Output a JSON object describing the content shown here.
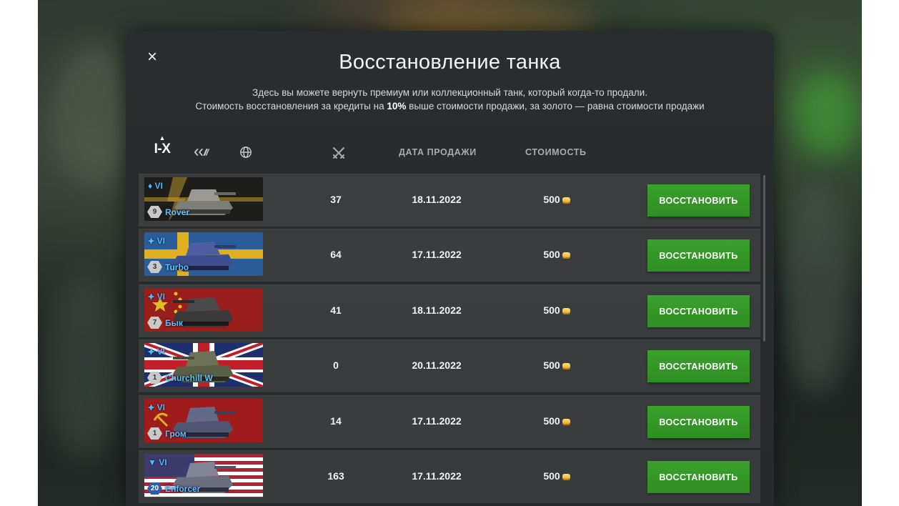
{
  "modal": {
    "title": "Восстановление танка",
    "close_label": "×",
    "desc_line1": "Здесь вы можете вернуть премиум или коллекционный танк, который когда-то продали.",
    "desc_line2_a": "Стоимость восстановления за кредиты на ",
    "desc_line2_b": "10%",
    "desc_line2_c": " выше стоимости продажи, за золото — равна стоимости продажи"
  },
  "filters": {
    "tier_label": "I-X",
    "tier_caret": "▲",
    "icons": [
      "tank-type-filter-icon",
      "nation-globe-icon"
    ]
  },
  "columns": {
    "battles_icon": "crossed-swords-icon",
    "date": "ДАТА ПРОДАЖИ",
    "cost": "СТОИМОСТЬ"
  },
  "rows": [
    {
      "type_tier": "♦ VI",
      "mastery": "9",
      "name": "Rover",
      "battles": "37",
      "date": "18.11.2022",
      "price": "500",
      "button": "ВОССТАНОВИТЬ",
      "flag": "black-gold"
    },
    {
      "type_tier": "⯌ VI",
      "mastery": "3",
      "name": "Turbo",
      "battles": "64",
      "date": "17.11.2022",
      "price": "500",
      "button": "ВОССТАНОВИТЬ",
      "flag": "sweden"
    },
    {
      "type_tier": "⯌ VI",
      "mastery": "7",
      "name": "Бык",
      "battles": "41",
      "date": "18.11.2022",
      "price": "500",
      "button": "ВОССТАНОВИТЬ",
      "flag": "china"
    },
    {
      "type_tier": "⯌ VI",
      "mastery": "1",
      "name": "Churchill W",
      "battles": "0",
      "date": "20.11.2022",
      "price": "500",
      "button": "ВОССТАНОВИТЬ",
      "flag": "uk"
    },
    {
      "type_tier": "⯌ VI",
      "mastery": "1",
      "name": "Гром",
      "battles": "14",
      "date": "17.11.2022",
      "price": "500",
      "button": "ВОССТАНОВИТЬ",
      "flag": "ussr"
    },
    {
      "type_tier": "▼ VI",
      "mastery": "20",
      "name": "Enforcer",
      "battles": "163",
      "date": "17.11.2022",
      "price": "500",
      "button": "ВОССТАНОВИТЬ",
      "flag": "usa"
    }
  ],
  "colors": {
    "accent_green": "#3aa12c",
    "tank_name_blue": "#5ec0ff",
    "modal_bg": "#2a2d2f"
  },
  "currency_icon": "gold-coin-icon"
}
